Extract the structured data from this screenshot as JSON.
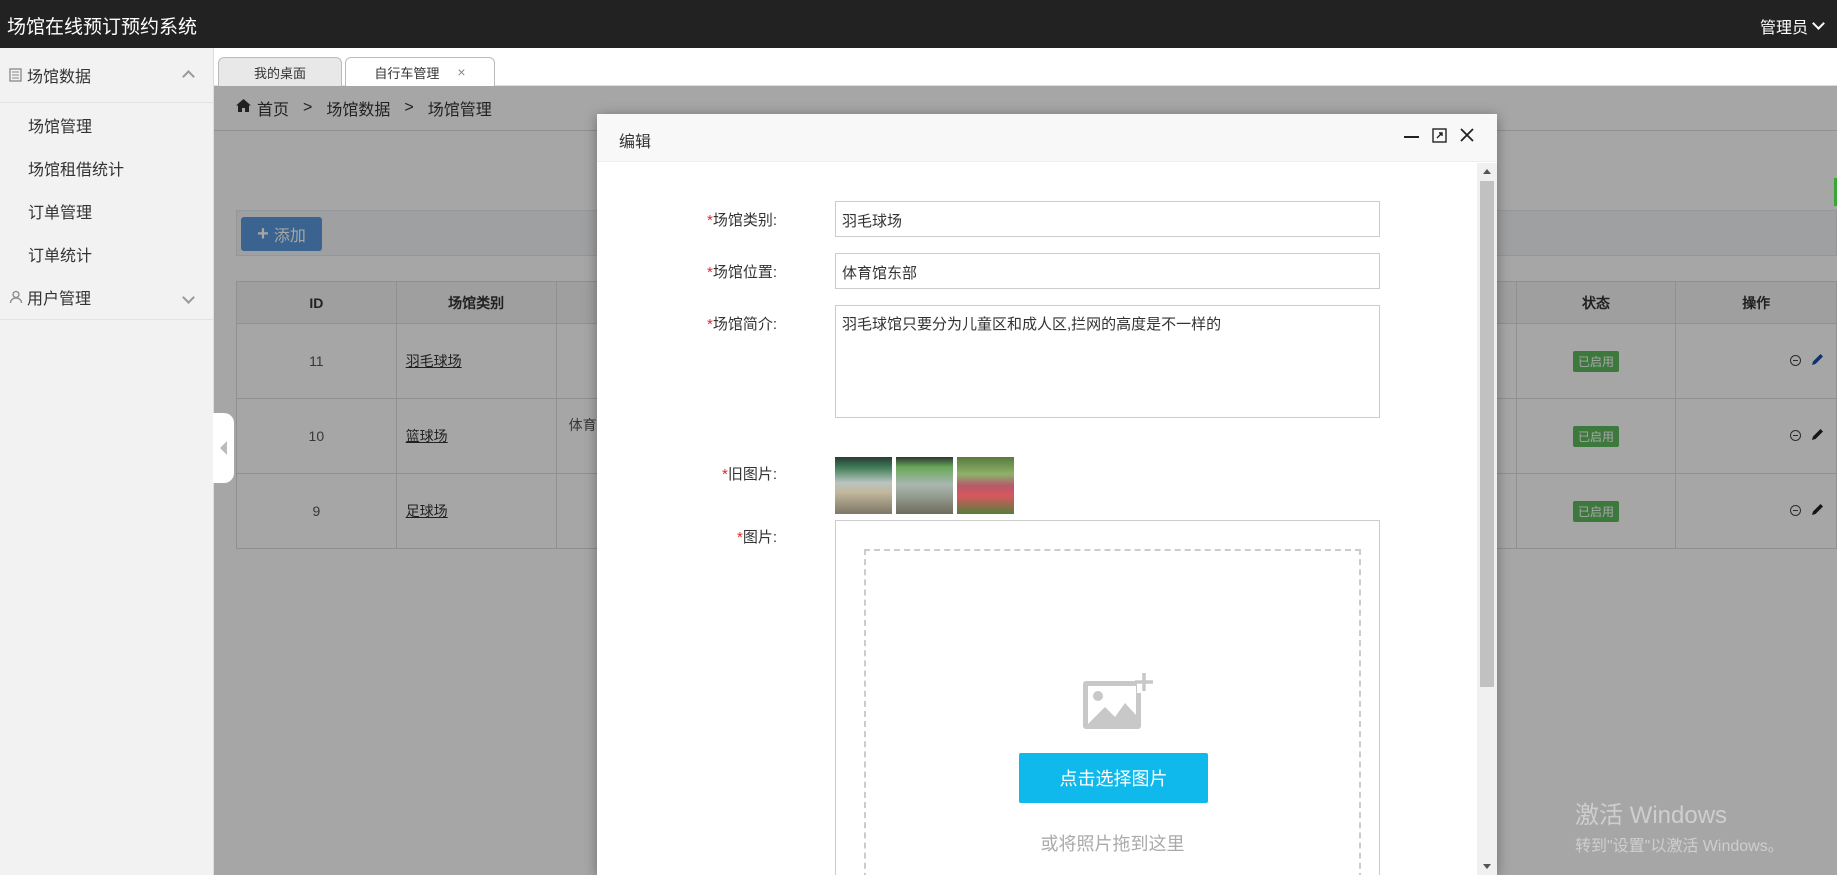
{
  "app": {
    "title": "场馆在线预订预约系统",
    "user": "管理员"
  },
  "sidebar": {
    "groups": [
      {
        "label": "场馆数据",
        "items": [
          {
            "label": "场馆管理"
          },
          {
            "label": "场馆租借统计"
          },
          {
            "label": "订单管理"
          },
          {
            "label": "订单统计"
          }
        ]
      },
      {
        "label": "用户管理"
      }
    ]
  },
  "tabs": [
    {
      "label": "我的桌面"
    },
    {
      "label": "自行车管理",
      "close": "×"
    }
  ],
  "breadcrumb": {
    "home": "首页",
    "level1": "场馆数据",
    "level2": "场馆管理",
    "sep": ">"
  },
  "toolbar": {
    "add_label": "添加"
  },
  "table": {
    "headers": {
      "id": "ID",
      "category": "场馆类别",
      "status": "状态",
      "ops": "操作"
    },
    "rows": [
      {
        "id": "11",
        "category": "羽毛球场",
        "location": "",
        "status": "已启用"
      },
      {
        "id": "10",
        "category": "篮球场",
        "location": "体育",
        "status": "已启用"
      },
      {
        "id": "9",
        "category": "足球场",
        "location": "",
        "status": "已启用"
      }
    ]
  },
  "modal": {
    "title": "编辑",
    "fields": {
      "category": {
        "label": "场馆类别:",
        "value": "羽毛球场"
      },
      "location": {
        "label": "场馆位置:",
        "value": "体育馆东部"
      },
      "intro": {
        "label": "场馆简介:",
        "value": "羽毛球馆只要分为儿童区和成人区,拦网的高度是不一样的"
      },
      "old_images": {
        "label": "旧图片:"
      },
      "images": {
        "label": "图片:"
      }
    },
    "required_mark": "*",
    "upload": {
      "button": "点击选择图片",
      "hint": "或将照片拖到这里"
    }
  },
  "watermark": {
    "line1": "激活 Windows",
    "line2": "转到\"设置\"以激活 Windows。"
  },
  "colors": {
    "topbar": "#222222",
    "add_button": "#5a98de",
    "badge": "#5eb95e",
    "upload_button": "#10b9ec",
    "required": "#ee2222"
  }
}
